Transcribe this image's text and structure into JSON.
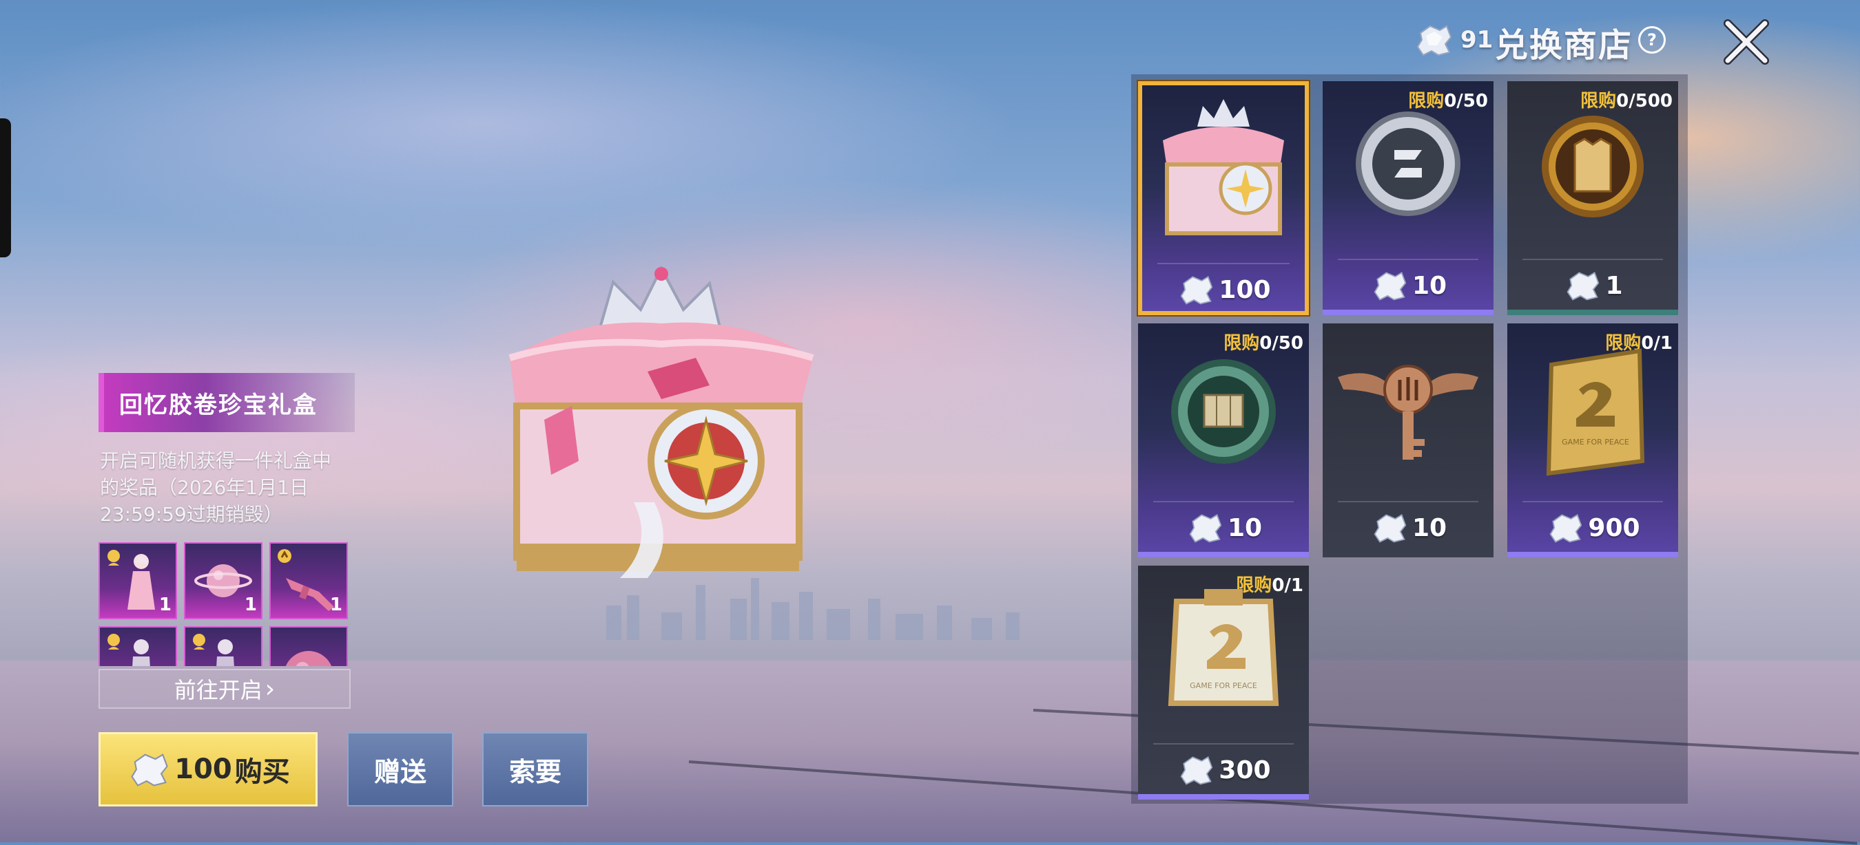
{
  "header": {
    "currency_value": "91",
    "shop_title": "兑换商店",
    "help_symbol": "?"
  },
  "featured": {
    "title": "回忆胶卷珍宝礼盒",
    "description": "开启可随机获得一件礼盒中的奖品（2026年1月1日23:59:59过期销毁）",
    "prizes": [
      {
        "icon": "pink-dress-character-icon",
        "count": "1"
      },
      {
        "icon": "pink-planet-orb-icon",
        "count": "1"
      },
      {
        "icon": "pink-rifle-icon",
        "count": "1"
      },
      {
        "icon": "character-outfit-icon",
        "count": ""
      },
      {
        "icon": "character-outfit-icon",
        "count": ""
      },
      {
        "icon": "pink-sphere-icon",
        "count": ""
      }
    ],
    "goto_label": "前往开启",
    "goto_arrow": "›",
    "buy_price": "100",
    "buy_label": "购买",
    "gift_label": "赠送",
    "request_label": "索要"
  },
  "shop_items": [
    {
      "name": "treasure-chest",
      "limit_prefix": "",
      "limit_count": "",
      "price": "100",
      "selected": true
    },
    {
      "name": "silver-coin",
      "limit_prefix": "限购",
      "limit_count": "0/50",
      "price": "10"
    },
    {
      "name": "gold-vest-coin",
      "limit_prefix": "限购",
      "limit_count": "0/500",
      "price": "1"
    },
    {
      "name": "green-map-coin",
      "limit_prefix": "限购",
      "limit_count": "0/50",
      "price": "10"
    },
    {
      "name": "bronze-winged-key",
      "limit_prefix": "",
      "limit_count": "",
      "price": "10"
    },
    {
      "name": "gold-badge",
      "limit_prefix": "限购",
      "limit_count": "0/1",
      "price": "900"
    },
    {
      "name": "silver-gold-badge",
      "limit_prefix": "限购",
      "limit_count": "0/1",
      "price": "300"
    }
  ],
  "badge_text": "GAME FOR PEACE",
  "colors": {
    "accent_gold": "#f1b43c",
    "limit_yellow": "#f3c13a",
    "banner_pink": "#c33bbf",
    "card_purple": "#5b46a8"
  }
}
